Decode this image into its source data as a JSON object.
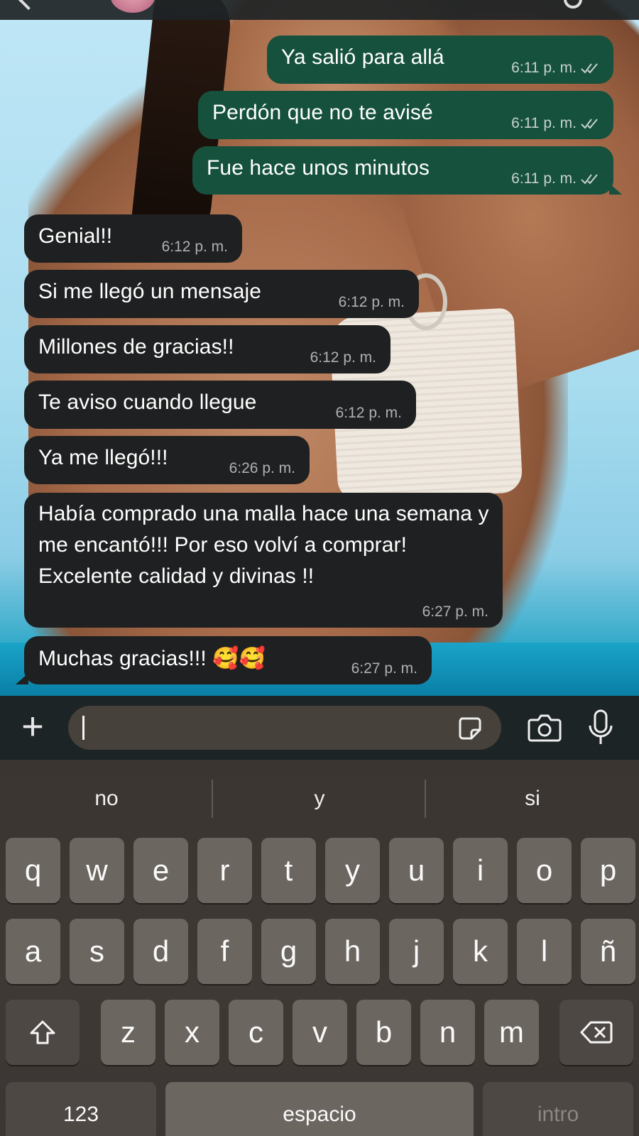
{
  "messages": [
    {
      "dir": "out",
      "text": "Ya salió para allá",
      "time": "6:11 p. m."
    },
    {
      "dir": "out",
      "text": "Perdón que no te avisé",
      "time": "6:11 p. m."
    },
    {
      "dir": "out",
      "text": "Fue hace unos minutos",
      "time": "6:11 p. m."
    },
    {
      "dir": "in",
      "text": "Genial!!",
      "time": "6:12 p. m."
    },
    {
      "dir": "in",
      "text": "Si me llegó un mensaje",
      "time": "6:12 p. m."
    },
    {
      "dir": "in",
      "text": "Millones de gracias!!",
      "time": "6:12 p. m."
    },
    {
      "dir": "in",
      "text": "Te aviso cuando llegue",
      "time": "6:12 p. m."
    },
    {
      "dir": "in",
      "text": "Ya me llegó!!!",
      "time": "6:26 p. m."
    },
    {
      "dir": "in",
      "text": "Había comprado una malla hace una semana y me encantó!!! Por eso volví a comprar! Excelente calidad y divinas !!",
      "time": "6:27 p. m."
    },
    {
      "dir": "in",
      "text": "Muchas gracias!!! 🥰🥰",
      "time": "6:27 p. m."
    }
  ],
  "composer": {
    "plus_icon": "plus-icon",
    "input_value": "",
    "sticker_icon": "sticker-icon",
    "camera_icon": "camera-icon",
    "mic_icon": "microphone-icon"
  },
  "keyboard": {
    "suggestions": [
      "no",
      "y",
      "si"
    ],
    "row1": [
      "q",
      "w",
      "e",
      "r",
      "t",
      "y",
      "u",
      "i",
      "o",
      "p"
    ],
    "row2": [
      "a",
      "s",
      "d",
      "f",
      "g",
      "h",
      "j",
      "k",
      "l",
      "ñ"
    ],
    "row3": [
      "z",
      "x",
      "c",
      "v",
      "b",
      "n",
      "m"
    ],
    "shift_icon": "shift-icon",
    "delete_icon": "backspace-icon",
    "numbers_label": "123",
    "space_label": "espacio",
    "return_label": "intro"
  },
  "colors": {
    "outgoing_bubble": "#15513d",
    "incoming_bubble": "#1f2021",
    "read_ticks": "#c9d2cd"
  }
}
